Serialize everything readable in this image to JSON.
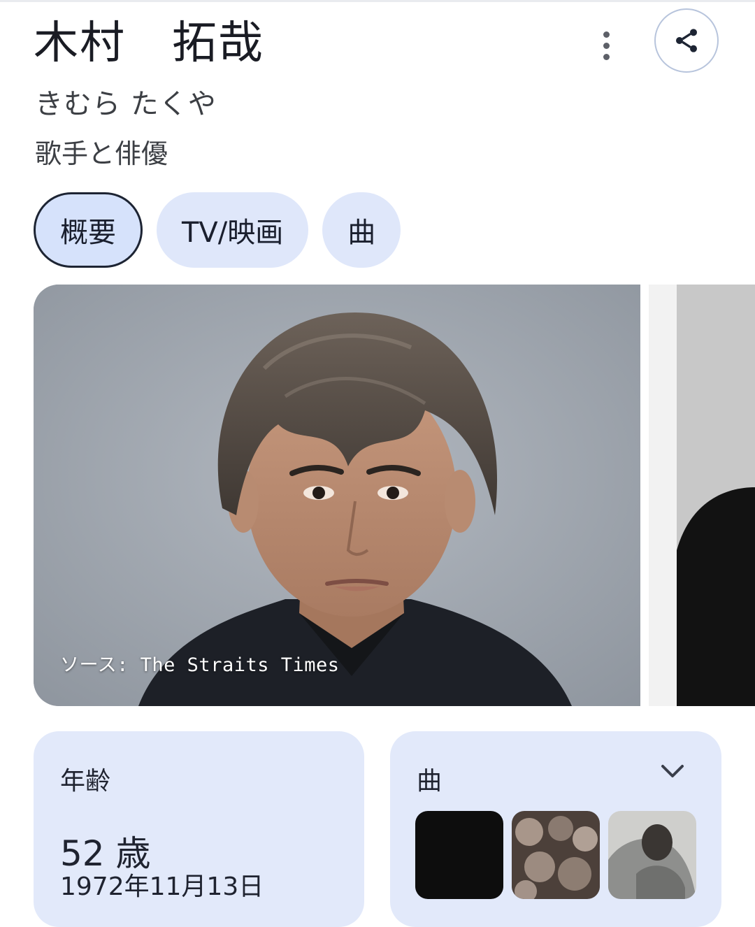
{
  "entity": {
    "name": "木村　拓哉",
    "reading": "きむら たくや",
    "description": "歌手と俳優"
  },
  "actions": {
    "more_icon": "more-vert-icon",
    "share_icon": "share-icon"
  },
  "tabs": [
    {
      "label": "概要",
      "selected": true
    },
    {
      "label": "TV/映画",
      "selected": false
    },
    {
      "label": "曲",
      "selected": false
    }
  ],
  "image": {
    "caption": "ソース: The Straits Times"
  },
  "age_card": {
    "label": "年齢",
    "value": "52 歳",
    "birthdate": "1972年11月13日"
  },
  "songs_card": {
    "label": "曲",
    "expand_icon": "chevron-down-icon"
  },
  "colors": {
    "chip_bg": "#dfe7fa",
    "card_bg": "#e2e9fa",
    "accent_dark": "#1d2433"
  }
}
